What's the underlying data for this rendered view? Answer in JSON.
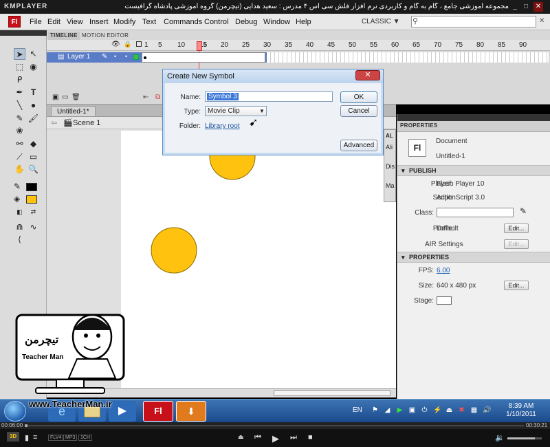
{
  "km": {
    "logo": "KMPLAYER",
    "title": "مجموعه آموزشی جامع ، گام به گام و کاربردی نرم افزار فلش سی اس ۴ مدرس : سعید هدایی (تیچرمن) گروه آموزشی پادشاه گرافیست ها",
    "time_elapsed": "00:06:00",
    "time_total": "00:30:21",
    "badges": [
      "FLV4",
      "MP3",
      "1CH"
    ]
  },
  "flash": {
    "logo": "Fl",
    "menu": [
      "File",
      "Edit",
      "View",
      "Insert",
      "Modify",
      "Text",
      "Commands",
      "Control",
      "Debug",
      "Window",
      "Help"
    ],
    "workspace": "CLASSIC ▼",
    "search_placeholder": ""
  },
  "timeline": {
    "tabs": [
      "TIMELINE",
      "MOTION EDITOR"
    ],
    "frame_numbers": [
      "1",
      "5",
      "10",
      "15",
      "20",
      "25",
      "30",
      "35",
      "40",
      "45",
      "50",
      "55",
      "60",
      "65",
      "70",
      "75",
      "80",
      "85",
      "90"
    ],
    "layer_name": "Layer 1"
  },
  "document": {
    "tab_title": "Untitled-1*",
    "scene": "Scene 1"
  },
  "dialog": {
    "title": "Create New Symbol",
    "name_label": "Name:",
    "name_value": "Symbol 3",
    "type_label": "Type:",
    "type_value": "Movie Clip",
    "folder_label": "Folder:",
    "folder_value": "Library root",
    "ok": "OK",
    "cancel": "Cancel",
    "advanced": "Advanced"
  },
  "library_strip": {
    "labels": [
      "AL",
      "Ali",
      "Dis",
      "Ma"
    ]
  },
  "properties": {
    "tab": "PROPERTIES",
    "doc_type": "Document",
    "doc_name": "Untitled-1",
    "publish_header": "PUBLISH",
    "player_label": "Player:",
    "player_value": "Flash Player 10",
    "script_label": "Script:",
    "script_value": "ActionScript 3.0",
    "class_label": "Class:",
    "profile_label": "Profile:",
    "profile_value": "Default",
    "air_label": "AIR Settings",
    "edit_label": "Edit...",
    "properties_header": "PROPERTIES",
    "fps_label": "FPS:",
    "fps_value": "6.00",
    "size_label": "Size:",
    "size_value": "640 x 480 px",
    "stage_label": "Stage:",
    "doc_icon": "Fl"
  },
  "taskbar": {
    "lang": "EN",
    "time": "8:39 AM",
    "date": "1/10/2011",
    "watermark": "www.TeacherMan.ir"
  },
  "cartoon": {
    "brand_fa": "تیچرمن",
    "brand_en": "Teacher Man"
  },
  "colors": {
    "circle_fill": "#ffc20e",
    "layer_selected": "#5a7cc7",
    "flash_red": "#c8101b"
  }
}
